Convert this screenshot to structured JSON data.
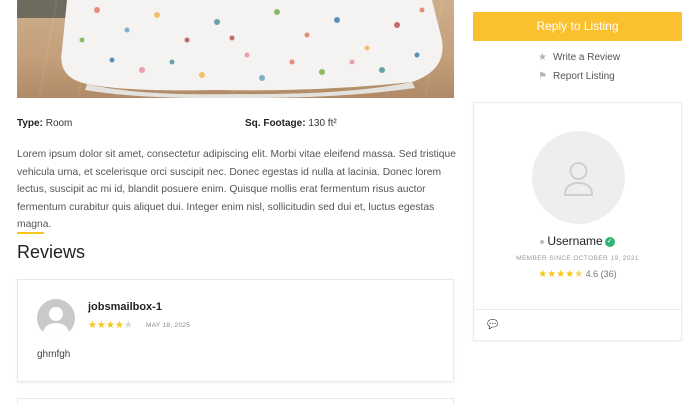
{
  "listing": {
    "details": {
      "type_label": "Type:",
      "type_value": " Room",
      "sqft_label": "Sq. Footage:",
      "sqft_value": " 130 ft²"
    },
    "description": "Lorem ipsum dolor sit amet, consectetur adipiscing elit. Morbi vitae eleifend massa. Sed tristique vehicula urna, et scelerisque orci suscipit nec. Donec egestas id nulla at lacinia. Donec lorem lectus, suscipit ac mi id, blandit posuere enim. Quisque mollis erat fermentum risus auctor fermentum curabitur quis aliquet dui. Integer enim nisl, sollicitudin sed dui et, luctus egestas magna."
  },
  "reviews": {
    "title": "Reviews",
    "items": [
      {
        "author": "jobsmailbox-1",
        "rating": 4,
        "date": "MAY 18, 2025",
        "text": "ghmfgh"
      }
    ]
  },
  "sidebar": {
    "reply_button": "Reply to Listing",
    "write_review": "Write a Review",
    "report_listing": "Report Listing",
    "write_icon": "star-icon",
    "report_icon": "flag-icon",
    "profile": {
      "username": "Username",
      "member_since": "MEMBER SINCE OCTOBER 19, 2021",
      "rating_value": "4.6",
      "rating_count": "(36)",
      "rating_stars": 4.5
    }
  },
  "colors": {
    "accent": "#f5c518",
    "button": "#fbc02d",
    "verified": "#2bb673"
  }
}
